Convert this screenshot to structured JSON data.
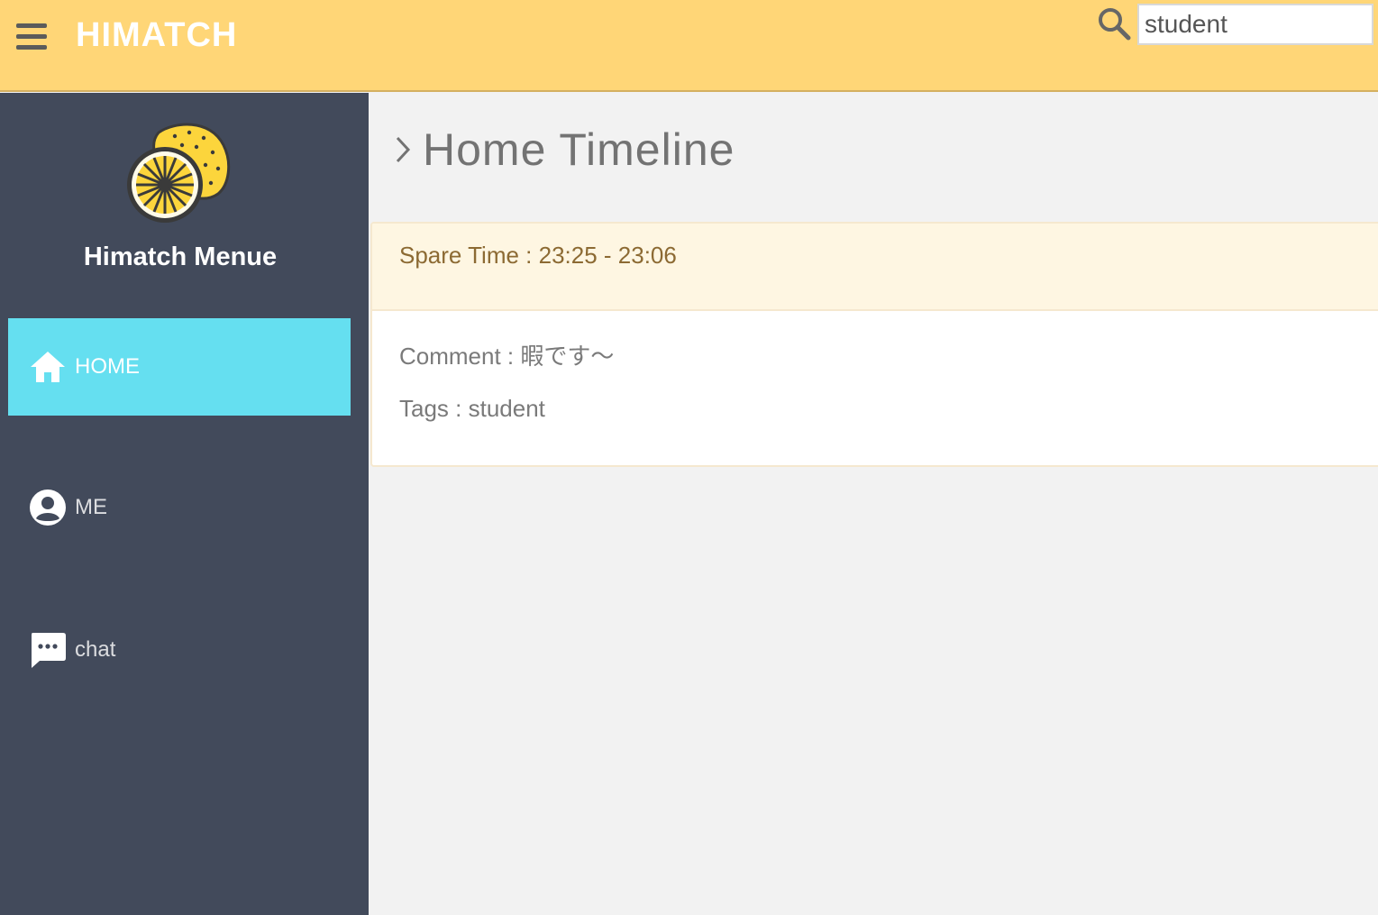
{
  "header": {
    "brand": "HIMATCH",
    "search": {
      "value": "student",
      "icon": "search-icon"
    },
    "menu_icon": "hamburger-menu-icon",
    "background_color": "#ffd677"
  },
  "sidebar": {
    "title": "Himatch Menue",
    "logo": "lemon-logo",
    "background_color": "#424a5b",
    "items": [
      {
        "label": "HOME",
        "icon": "home-icon",
        "active": true
      },
      {
        "label": "ME",
        "icon": "account-circle-icon",
        "active": false
      },
      {
        "label": "chat",
        "icon": "chat-bubble-icon",
        "active": false
      }
    ],
    "active_color": "#65dff0"
  },
  "main": {
    "title": "Home Timeline",
    "posts": [
      {
        "spare_time": "Spare Time : 23:25 - 23:06",
        "comment": "Comment : 暇です〜",
        "tags": "Tags : student"
      }
    ]
  }
}
